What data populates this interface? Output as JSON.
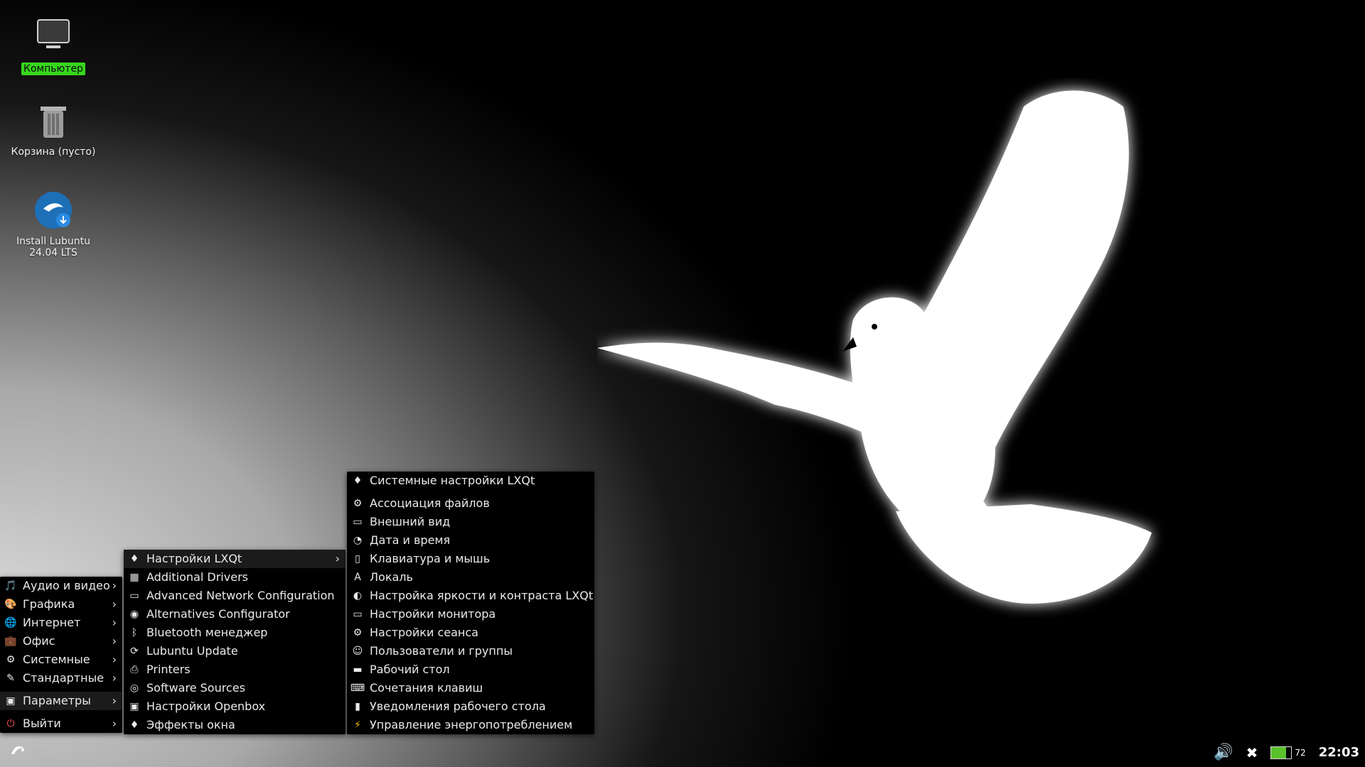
{
  "desktop": {
    "icons": [
      {
        "label": "Компьютер",
        "selected": true
      },
      {
        "label": "Корзина (пусто)"
      },
      {
        "label": "Install Lubuntu 24.04 LTS",
        "line1": "Install Lubuntu",
        "line2": "24.04 LTS"
      }
    ]
  },
  "main_menu": {
    "items": [
      {
        "label": "Аудио и видео",
        "icon": "multimedia-icon"
      },
      {
        "label": "Графика",
        "icon": "graphics-icon"
      },
      {
        "label": "Интернет",
        "icon": "internet-icon"
      },
      {
        "label": "Офис",
        "icon": "office-icon"
      },
      {
        "label": "Системные",
        "icon": "system-icon"
      },
      {
        "label": "Стандартные",
        "icon": "accessories-icon"
      },
      {
        "label": "Параметры",
        "icon": "preferences-icon"
      },
      {
        "label": "Выйти",
        "icon": "power-icon"
      }
    ]
  },
  "submenu_preferences": {
    "items": [
      {
        "label": "Настройки LXQt",
        "icon": "lxqt-icon"
      },
      {
        "label": "Additional Drivers",
        "icon": "drivers-icon"
      },
      {
        "label": "Advanced Network Configuration",
        "icon": "network-icon"
      },
      {
        "label": "Alternatives Configurator",
        "icon": "alternatives-icon"
      },
      {
        "label": "Bluetooth менеджер",
        "icon": "bluetooth-icon"
      },
      {
        "label": "Lubuntu Update",
        "icon": "update-icon"
      },
      {
        "label": "Printers",
        "icon": "printer-icon"
      },
      {
        "label": "Software Sources",
        "icon": "sources-icon"
      },
      {
        "label": "Настройки Openbox",
        "icon": "openbox-icon"
      },
      {
        "label": "Эффекты окна",
        "icon": "effects-icon"
      }
    ]
  },
  "submenu_lxqt": {
    "items": [
      {
        "label": "Системные настройки LXQt",
        "icon": "lxqt-icon"
      },
      {
        "label": "Ассоциация файлов",
        "icon": "gear-icon"
      },
      {
        "label": "Внешний вид",
        "icon": "appearance-icon"
      },
      {
        "label": "Дата и время",
        "icon": "clock-icon"
      },
      {
        "label": "Клавиатура и мышь",
        "icon": "mouse-icon"
      },
      {
        "label": "Локаль",
        "icon": "locale-icon"
      },
      {
        "label": "Настройка яркости и контраста LXQt",
        "icon": "brightness-icon"
      },
      {
        "label": "Настройки монитора",
        "icon": "monitor-icon"
      },
      {
        "label": "Настройки сеанса",
        "icon": "session-icon"
      },
      {
        "label": "Пользователи и группы",
        "icon": "users-icon"
      },
      {
        "label": "Рабочий стол",
        "icon": "desktop-icon"
      },
      {
        "label": "Сочетания клавиш",
        "icon": "keyboard-icon"
      },
      {
        "label": "Уведомления рабочего стола",
        "icon": "notifications-icon"
      },
      {
        "label": "Управление энергопотреблением",
        "icon": "power-management-icon"
      }
    ]
  },
  "taskbar": {
    "clock": "22:03",
    "battery_percent": "72"
  },
  "colors": {
    "menu_bg": "#000000",
    "selected_label_bg": "#37d61d"
  }
}
